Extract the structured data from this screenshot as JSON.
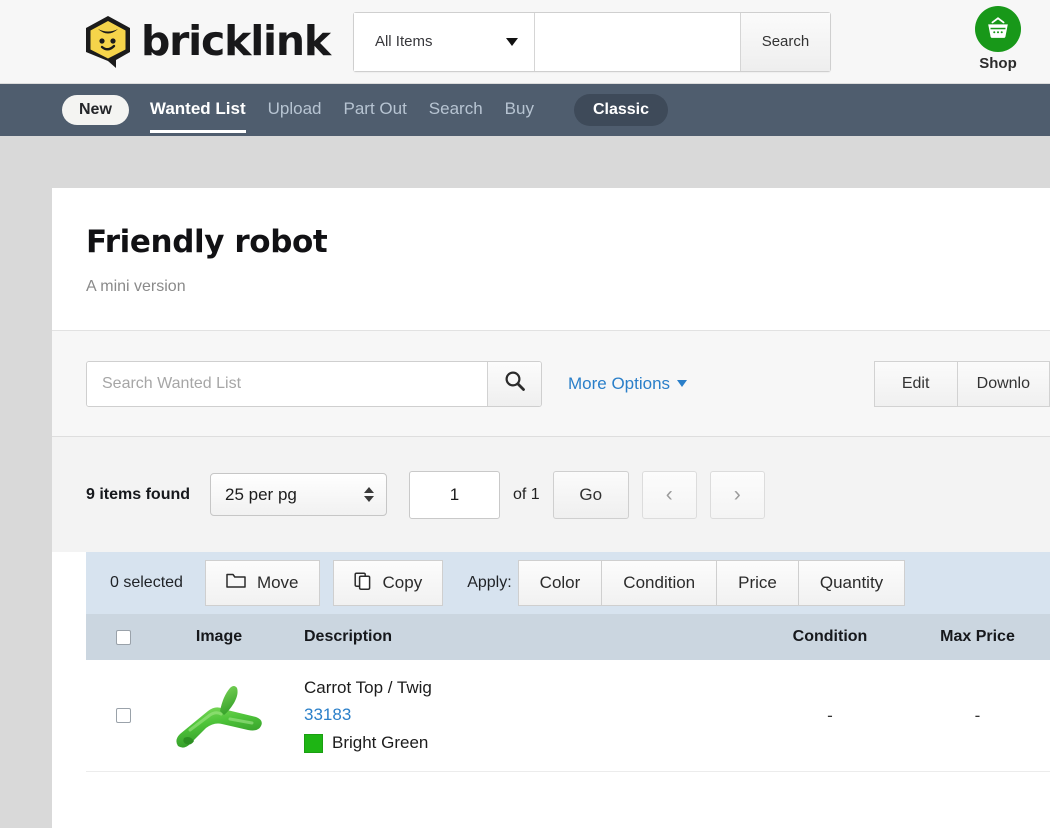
{
  "header": {
    "logo_text": "bricklink",
    "logo_icon": "bricklink-brick-face-logo",
    "search_category": "All Items",
    "search_value": "",
    "search_placeholder": "",
    "search_icon": "magnifier-plus-icon",
    "search_button": "Search",
    "shop_label": "Shop",
    "shop_icon": "shopping-basket-icon"
  },
  "nav": {
    "new_pill": "New",
    "items": [
      {
        "label": "Wanted List",
        "active": true
      },
      {
        "label": "Upload",
        "active": false
      },
      {
        "label": "Part Out",
        "active": false
      },
      {
        "label": "Search",
        "active": false
      },
      {
        "label": "Buy",
        "active": false
      }
    ],
    "classic_pill": "Classic"
  },
  "page": {
    "title": "Friendly robot",
    "subtitle": "A mini version"
  },
  "tools": {
    "search_value": "",
    "search_placeholder": "Search Wanted List",
    "search_icon": "search-icon",
    "more_options": "More Options",
    "edit_button": "Edit",
    "download_button": "Downlo"
  },
  "pager": {
    "items_found": "9 items found",
    "per_page": "25 per pg",
    "page_value": "1",
    "of_total": "of 1",
    "go_button": "Go",
    "prev_icon": "‹",
    "next_icon": "›"
  },
  "bulkbar": {
    "selected_count": "0 selected",
    "move_button": "Move",
    "move_icon": "folder-icon",
    "copy_button": "Copy",
    "copy_icon": "copy-icon",
    "apply_label": "Apply:",
    "apply_buttons": [
      "Color",
      "Condition",
      "Price",
      "Quantity"
    ]
  },
  "table": {
    "columns": [
      "",
      "Image",
      "Description",
      "Condition",
      "Max Price"
    ],
    "rows": [
      {
        "name": "Carrot Top / Twig",
        "part_no": "33183",
        "color": "Bright Green",
        "color_hex": "#1eb514",
        "condition": "-",
        "max_price": "-",
        "image_icon": "lego-carrot-top-twig-green"
      }
    ]
  },
  "colors": {
    "navbar_bg": "#4f5d6e",
    "accent_link": "#2a7fc9",
    "bulkbar_bg": "#d7e3ef",
    "table_head_bg": "#cbd6e0",
    "shop_green": "#189819",
    "page_bg": "#d9d9d9"
  }
}
